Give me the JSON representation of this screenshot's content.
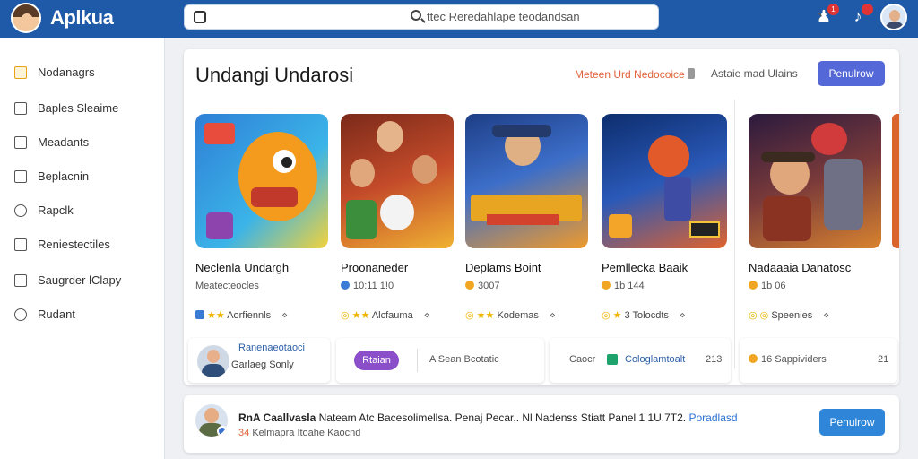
{
  "header": {
    "brand": "Aplkua",
    "search": {
      "query": "ttec Reredahlape teodandsan"
    },
    "notification_count": "1"
  },
  "sidebar": {
    "items": [
      {
        "label": "Nodanagrs",
        "icon": "checkbox-icon"
      },
      {
        "label": "Baples Sleaime",
        "icon": "document-icon"
      },
      {
        "label": "Meadants",
        "icon": "square-icon"
      },
      {
        "label": "Beplacnin",
        "icon": "page-icon"
      },
      {
        "label": "Rapclk",
        "icon": "search-icon"
      },
      {
        "label": "Reniestectiles",
        "icon": "square-icon"
      },
      {
        "label": "Saugrder lClapy",
        "icon": "home-icon"
      },
      {
        "label": "Rudant",
        "icon": "tools-icon"
      }
    ]
  },
  "main": {
    "title": "Undangi Undarosi",
    "header_link": "Meteen Urd Nedocoice",
    "header_text": "Astaie mad Ulains",
    "follow_label": "Penulrow",
    "games": [
      {
        "title": "Neclenla Undargh",
        "meta": "Meatecteocles",
        "rating": "Aorfiennls"
      },
      {
        "title": "Proonaneder",
        "meta": "10:11 1!0",
        "rating": "Alcfauma"
      },
      {
        "title": "Deplams Boint",
        "meta": "3007",
        "rating": "Kodemas"
      },
      {
        "title": "Pemllecka Baaik",
        "meta": "1b 144",
        "rating": "3 Tolocdts"
      },
      {
        "title": "Nadaaaia Danatosc",
        "meta": "1b 06",
        "rating": "Speenies"
      }
    ],
    "strip": {
      "user_name": "Ranenaeotaoci",
      "user_sub": "Garlaeg Sonly",
      "pill": "Rtaian",
      "field_text": "A Sean Bcotatic",
      "cancel": "Caocr",
      "check_label": "Cologlamtoalt",
      "check_count": "213",
      "supp_text": "16 Sappividers",
      "supp_count": "21"
    }
  },
  "post": {
    "name": "RnA Caallvasla",
    "text": "Nateam Atc Bacesolimellsa. Penaj Pecar.. Nl Nadenss Stiatt Panel 1 1U.7T2.",
    "link": "Poradlasd",
    "count": "34",
    "sub": "Kelmapra Itoahe Kaocnd",
    "follow_label": "Penulrow"
  },
  "colors": {
    "brand": "#1f5aa8",
    "accent": "#e0623a",
    "button": "#3a6fd8"
  }
}
